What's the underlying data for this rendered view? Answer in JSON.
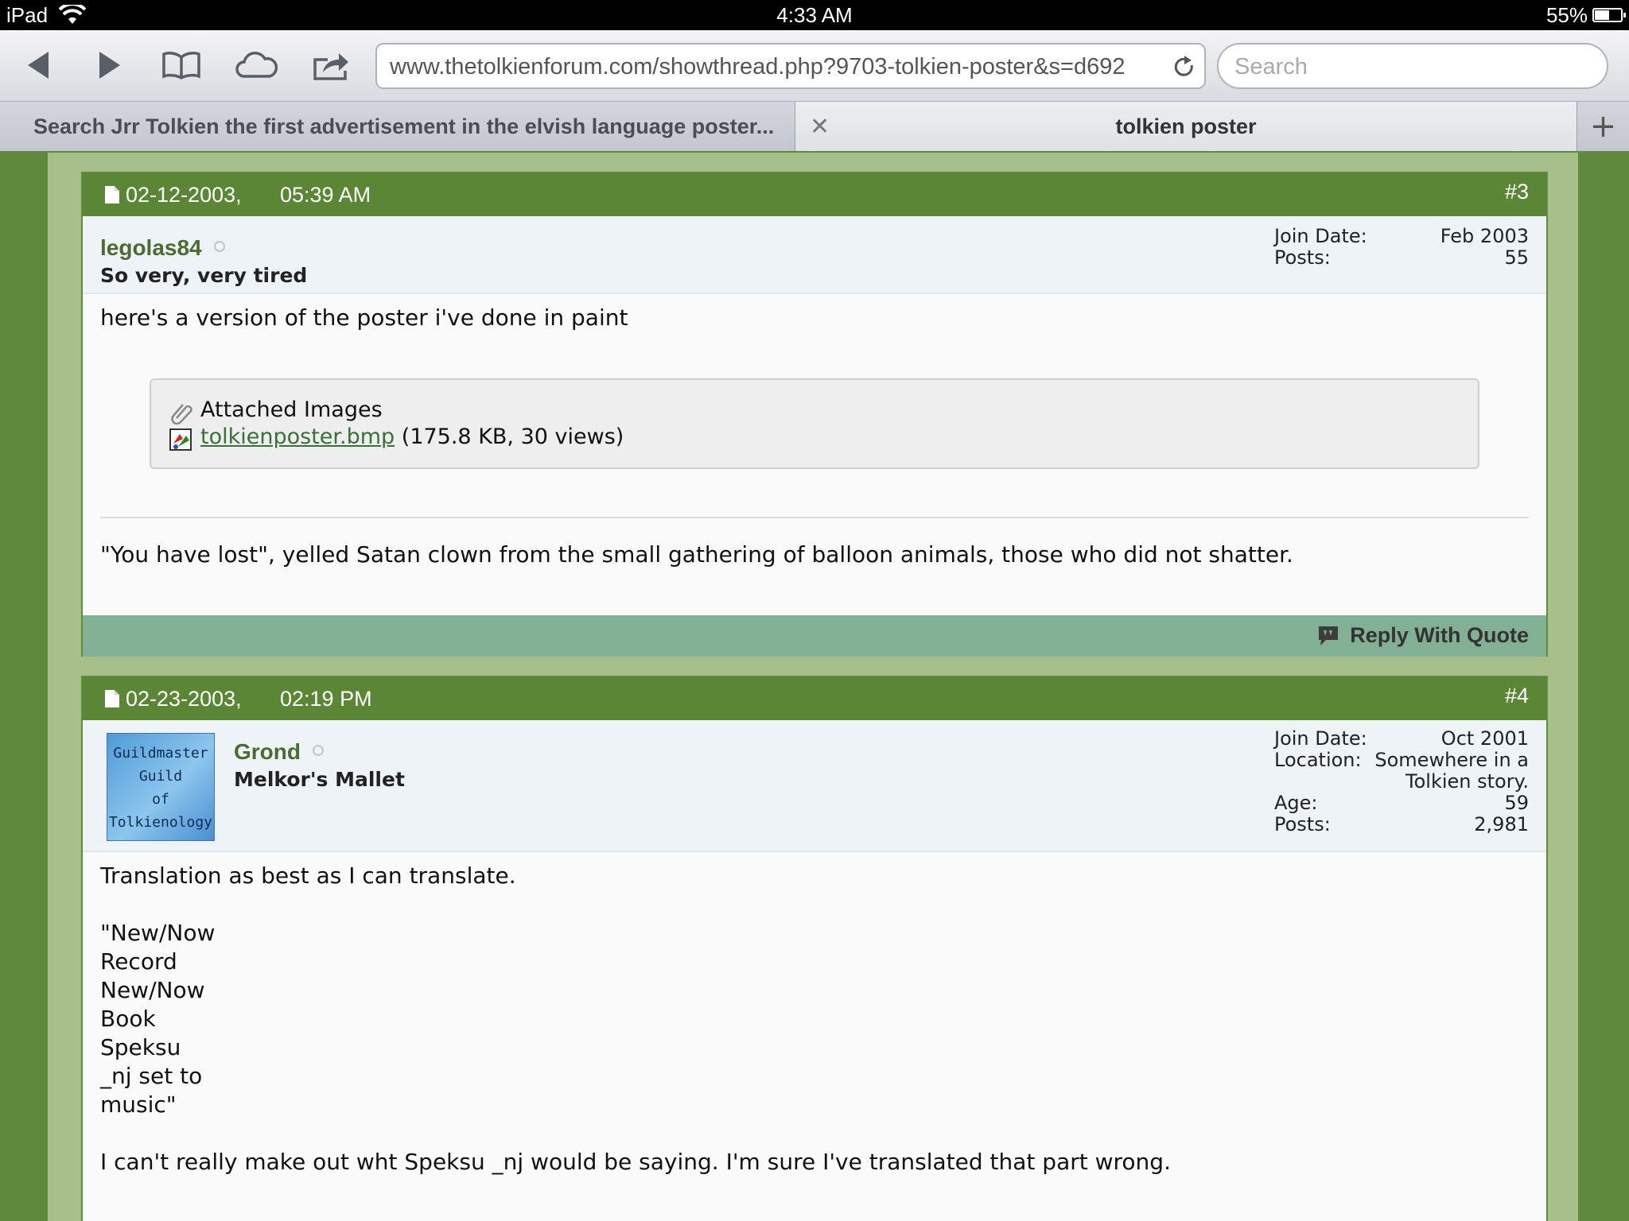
{
  "status_bar": {
    "device": "iPad",
    "time": "4:33 AM",
    "battery": "55%",
    "battery_level": 0.55
  },
  "toolbar": {
    "url": "www.thetolkienforum.com/showthread.php?9703-tolkien-poster&s=d692",
    "search_placeholder": "Search",
    "icons": [
      "back-icon",
      "forward-icon",
      "bookmarks-icon",
      "icloud-tabs-icon",
      "share-icon",
      "reload-icon"
    ]
  },
  "tabs": [
    {
      "label": "Search Jrr Tolkien the first advertisement in the elvish language poster...",
      "active": false
    },
    {
      "label": "tolkien poster",
      "active": true
    }
  ],
  "new_tab_label": "+",
  "posts": [
    {
      "date": "02-12-2003,",
      "time": "05:39 AM",
      "number": "#3",
      "username": "legolas84",
      "usertitle": "So very, very tired",
      "stats": [
        {
          "label": "Join Date:",
          "value": "Feb 2003"
        },
        {
          "label": "Posts:",
          "value": "55"
        }
      ],
      "message": "here's a version of the poster i've done in paint",
      "attachments": {
        "title": "Attached Images",
        "file_name": "tolkienposter.bmp",
        "file_info": "(175.8 KB, 30 views)"
      },
      "signature": "\"You have lost\", yelled Satan clown from the small gathering of balloon animals, those who did not shatter.",
      "reply_label": "Reply With Quote"
    },
    {
      "date": "02-23-2003,",
      "time": "02:19 PM",
      "number": "#4",
      "username": "Grond",
      "usertitle": "Melkor's Mallet",
      "avatar_lines": [
        "Guildmaster",
        "Guild",
        "of",
        "Tolkienology"
      ],
      "stats": [
        {
          "label": "Join Date:",
          "value": "Oct 2001"
        },
        {
          "label": "Location:",
          "value": "Somewhere in a"
        },
        {
          "label": "",
          "value": "Tolkien story."
        },
        {
          "label": "Age:",
          "value": "59"
        },
        {
          "label": "Posts:",
          "value": "2,981"
        }
      ],
      "message_lines": [
        "Translation as best as I can translate.",
        "",
        "\"New/Now",
        "Record",
        "New/Now",
        "Book",
        "Speksu",
        "_nj set to",
        "music\"",
        "",
        "I can't really make out wht Speksu _nj would be saying. I'm sure I've translated that part wrong."
      ]
    }
  ],
  "colors": {
    "page_bg": "#5f8a3e",
    "frame_bg": "#a7c08a",
    "post_header": "#5b8636",
    "post_footer": "#82b095",
    "username": "#4c6a31",
    "link": "#3c6e3a"
  }
}
